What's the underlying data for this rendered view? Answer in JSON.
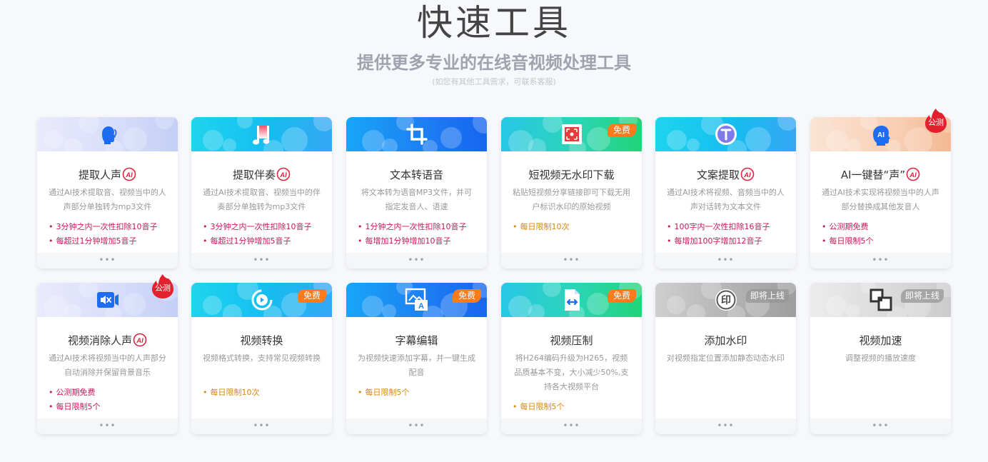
{
  "page": {
    "title": "快速工具",
    "subtitle": "提供更多专业的在线音视频处理工具",
    "note": "(如您有其他工具需求，可联系客服)"
  },
  "colors": {
    "feature_red": "#c8175a",
    "feature_orange": "#d6890f",
    "tag_free": "#ff7a1a",
    "flame": "#e3202d"
  },
  "cards": [
    {
      "title": "提取人声",
      "ai": true,
      "desc": "通过AI技术提取音、视频当中的人声部分单独转为mp3文件",
      "features": [
        "3分钟之内一次性扣除10音子",
        "每超过1分钟增加5音子"
      ],
      "feature_color": "red",
      "icon": "head-voice-icon",
      "banner": "lavender",
      "footer": "•••"
    },
    {
      "title": "提取伴奏",
      "ai": true,
      "desc": "通过AI技术提取音、视频当中的伴奏部分单独转为mp3文件",
      "features": [
        "3分钟之内一次性扣除10音子",
        "每超过1分钟增加5音子"
      ],
      "feature_color": "red",
      "icon": "music-note-icon",
      "banner": "cyan",
      "footer": "•••"
    },
    {
      "title": "文本转语音",
      "ai": false,
      "desc": "将文本转为语音MP3文件，并可指定发音人、语速",
      "features": [
        "1分钟之内一次性扣除10音子",
        "每增加1分钟增加10音子"
      ],
      "feature_color": "red",
      "icon": "crop-icon",
      "banner": "blue",
      "footer": "•••"
    },
    {
      "title": "短视频无水印下载",
      "ai": false,
      "desc": "粘贴短视频分享链接即可下载无用户标识水印的原始视频",
      "features": [
        "每日限制10次"
      ],
      "feature_color": "orange",
      "icon": "scan-icon",
      "banner": "green",
      "tag": "免费",
      "footer": "•••"
    },
    {
      "title": "文案提取",
      "ai": true,
      "desc": "通过AI技术将视频、音频当中的人声对话转为文本文件",
      "features": [
        "100字内一次性扣除16音子",
        "每增加100字增加12音子"
      ],
      "feature_color": "red",
      "icon": "text-t-icon",
      "banner": "cyan",
      "footer": "•••"
    },
    {
      "title": "AI一键替“声”",
      "ai": true,
      "desc": "通过AI技术实现将视频当中的人声部分替换成其他发音人",
      "features": [
        "公测期免费",
        "每日限制5个"
      ],
      "feature_color": "red",
      "icon": "ai-head-icon",
      "banner": "peach",
      "beta": "公测",
      "footer": "•••"
    },
    {
      "title": "视频消除人声",
      "ai": true,
      "desc": "通过AI技术将视频当中的人声部分自动消除并保留背景音乐",
      "features": [
        "公测期免费",
        "每日限制5个"
      ],
      "feature_color": "red",
      "icon": "mute-video-icon",
      "banner": "lavender",
      "beta": "公测",
      "footer": "•••"
    },
    {
      "title": "视频转换",
      "ai": false,
      "desc": "视频格式转换，支持常见视频转换",
      "features": [
        "每日限制10次"
      ],
      "feature_color": "orange",
      "icon": "convert-icon",
      "banner": "cyan",
      "tag": "免费",
      "footer": "•••"
    },
    {
      "title": "字幕编辑",
      "ai": false,
      "desc": "为视频快速添加字幕，并一键生成配音",
      "features": [
        "每日限制5个"
      ],
      "feature_color": "orange",
      "icon": "subtitle-icon",
      "banner": "blue",
      "tag": "免费",
      "footer": "•••"
    },
    {
      "title": "视频压制",
      "ai": false,
      "desc": "将H264编码升级为H265，视频品质基本不变，大小减少50%,支持各大视频平台",
      "features": [
        "每日限制5个"
      ],
      "feature_color": "orange",
      "icon": "compress-file-icon",
      "banner": "green",
      "tag": "免费",
      "footer": "•••"
    },
    {
      "title": "添加水印",
      "ai": false,
      "desc": "对视频指定位置添加静态动态水印",
      "features": [],
      "feature_color": "orange",
      "icon": "watermark-icon",
      "banner": "gray",
      "soon": "即将上线",
      "footer": "•••"
    },
    {
      "title": "视频加速",
      "ai": false,
      "desc": "调整视频的播放速度",
      "features": [],
      "feature_color": "orange",
      "icon": "speed-icon",
      "banner": "lightgray",
      "soon": "即将上线",
      "footer": "•••"
    }
  ]
}
